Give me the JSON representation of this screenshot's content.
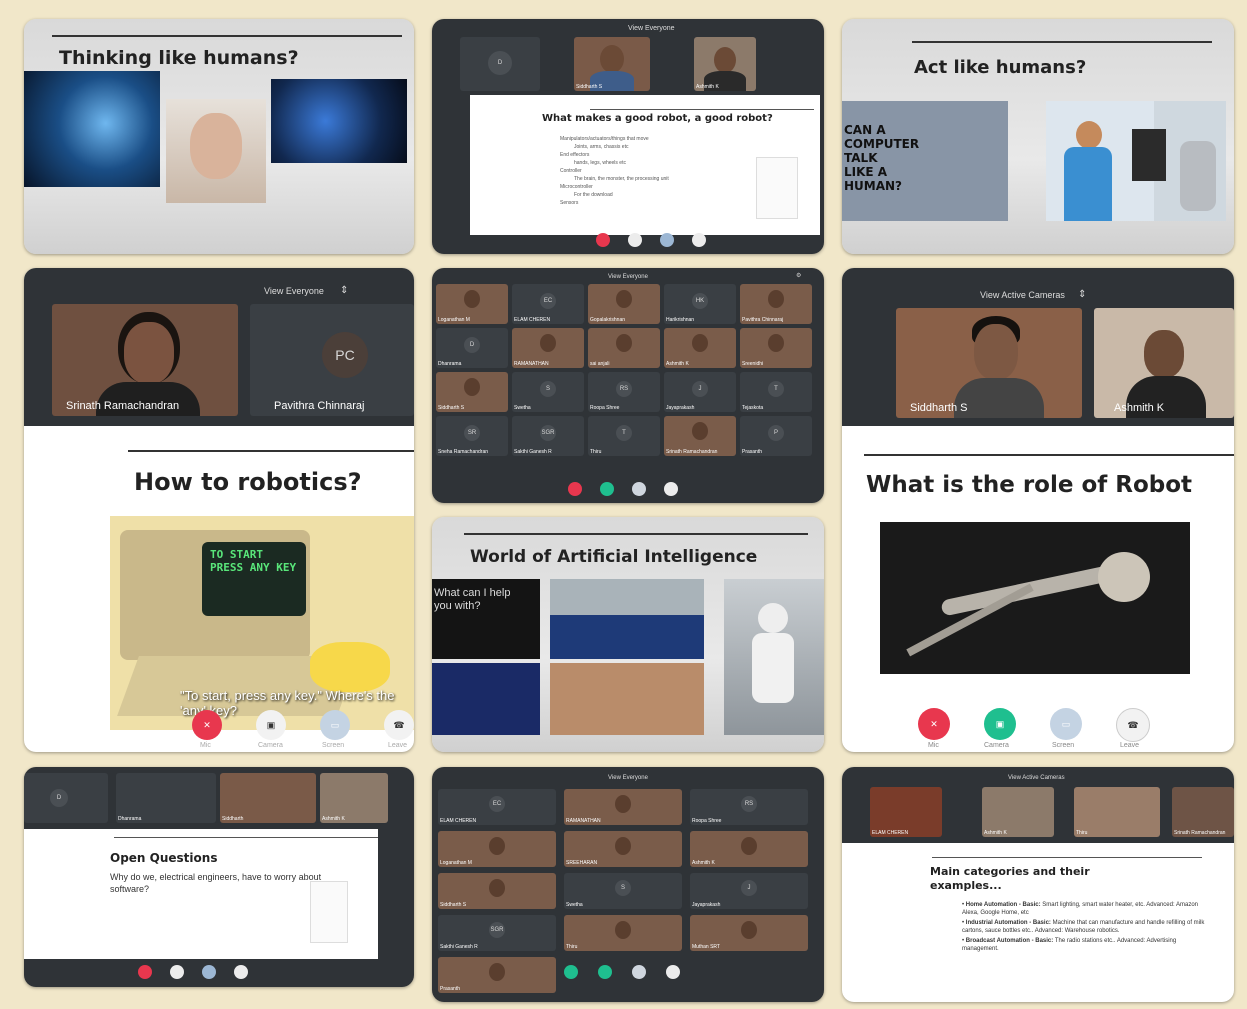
{
  "panel1": {
    "title": "Thinking like humans?"
  },
  "panel2": {
    "slide_title": "What makes a good robot, a good robot?",
    "bullets": [
      "Manipulators/actuators/things that move",
      "Joints, arms, chassis etc",
      "End effectors",
      "hands, legs, wheels etc",
      "Controller",
      "The brain, the monster, the processing unit",
      "Microcontroller",
      "For the download",
      "Sensors"
    ],
    "view_label": "View Everyone",
    "participants": [
      "Siddharth S",
      "Ashmith K"
    ]
  },
  "panel3": {
    "title": "Act like humans?",
    "comic_text": "CAN A COMPUTER TALK LIKE A HUMAN?"
  },
  "panel4": {
    "view_label": "View Everyone",
    "participant1": "Srinath Ramachandran",
    "participant2": "Pavithra Chinnaraj",
    "participant2_initials": "PC",
    "slide_title": "How to robotics?",
    "screen_text": "TO START PRESS ANY KEY",
    "subtitle_text": "\"To start, press any key.\" Where's the 'any' key?",
    "controls": [
      "Mic",
      "Camera",
      "Screen",
      "Leave"
    ]
  },
  "panel5": {
    "view_label": "View Everyone",
    "tiles": [
      {
        "name": "Loganathan M",
        "initials": ""
      },
      {
        "name": "ELAM CHEREN",
        "initials": "EC"
      },
      {
        "name": "Gopalakrishnan",
        "initials": ""
      },
      {
        "name": "Harikrishnan",
        "initials": "HK"
      },
      {
        "name": "Pavithra Chinnaraj",
        "initials": ""
      },
      {
        "name": "Dhanrama",
        "initials": "D"
      },
      {
        "name": "RAMANATHAN",
        "initials": ""
      },
      {
        "name": "sai anjali",
        "initials": ""
      },
      {
        "name": "Ashmith K",
        "initials": ""
      },
      {
        "name": "Sreenidhi",
        "initials": ""
      },
      {
        "name": "Siddharth S",
        "initials": ""
      },
      {
        "name": "Swetha",
        "initials": "S"
      },
      {
        "name": "Roopa Shree",
        "initials": "RS"
      },
      {
        "name": "Jayaprakash",
        "initials": "J"
      },
      {
        "name": "Tejaskota",
        "initials": "T"
      },
      {
        "name": "Sneha Ramachandran",
        "initials": "SR"
      },
      {
        "name": "Sakthi Ganesh R",
        "initials": "SGR"
      },
      {
        "name": "Thiru",
        "initials": "T"
      },
      {
        "name": "Srinath Ramachandran",
        "initials": ""
      },
      {
        "name": "Prasanth",
        "initials": "P"
      }
    ]
  },
  "panel6": {
    "view_label": "View Active Cameras",
    "participant1": "Siddharth S",
    "participant2": "Ashmith K",
    "slide_title": "What is the role of Robot",
    "controls": [
      "Mic",
      "Camera",
      "Screen",
      "Leave"
    ]
  },
  "panel7": {
    "title": "World of Artificial Intelligence",
    "assistant_text": "What can I help you with?"
  },
  "panel8": {
    "top_tiles": [
      "D",
      "Dhanrama",
      "Siddharth",
      "Ashmith K"
    ],
    "slide_title": "Open Questions",
    "slide_body": "Why do we, electrical engineers, have to worry about software?"
  },
  "panel9": {
    "view_label": "View Everyone",
    "tiles": [
      {
        "name": "ELAM CHEREN",
        "initials": "EC"
      },
      {
        "name": "RAMANATHAN",
        "initials": ""
      },
      {
        "name": "Roopa Shree",
        "initials": "RS"
      },
      {
        "name": "Loganathan M",
        "initials": ""
      },
      {
        "name": "SREEHARAN",
        "initials": ""
      },
      {
        "name": "Ashmith K",
        "initials": ""
      },
      {
        "name": "Siddharth S",
        "initials": ""
      },
      {
        "name": "Swetha",
        "initials": "S"
      },
      {
        "name": "Jayaprakash",
        "initials": "J"
      },
      {
        "name": "Sakthi Ganesh R",
        "initials": "SGR"
      },
      {
        "name": "Thiru",
        "initials": ""
      },
      {
        "name": "Muthan SRT",
        "initials": ""
      },
      {
        "name": "Prasanth",
        "initials": ""
      }
    ]
  },
  "panel10": {
    "view_label": "View Active Cameras",
    "top_names": [
      "ELAM CHEREN",
      "Ashmith K",
      "Thiru",
      "Srinath Ramachandran"
    ],
    "slide_title": "Main categories and their examples...",
    "items": [
      {
        "head": "Home Automation - Basic:",
        "text": "Smart lighting, smart water heater, etc. Advanced: Amazon Alexa, Google Home, etc"
      },
      {
        "head": "Industrial Automation - Basic:",
        "text": "Machine that can manufacture and handle refilling of milk cartons, sauce bottles etc.. Advanced: Warehouse robotics."
      },
      {
        "head": "Broadcast Automation - Basic:",
        "text": "The radio stations etc.. Advanced: Advertising management."
      }
    ]
  },
  "colors": {
    "background": "#f1e7c9",
    "meet_dark": "#2f3337",
    "mic_red": "#e8374e",
    "camera_green": "#1fbf8f"
  }
}
